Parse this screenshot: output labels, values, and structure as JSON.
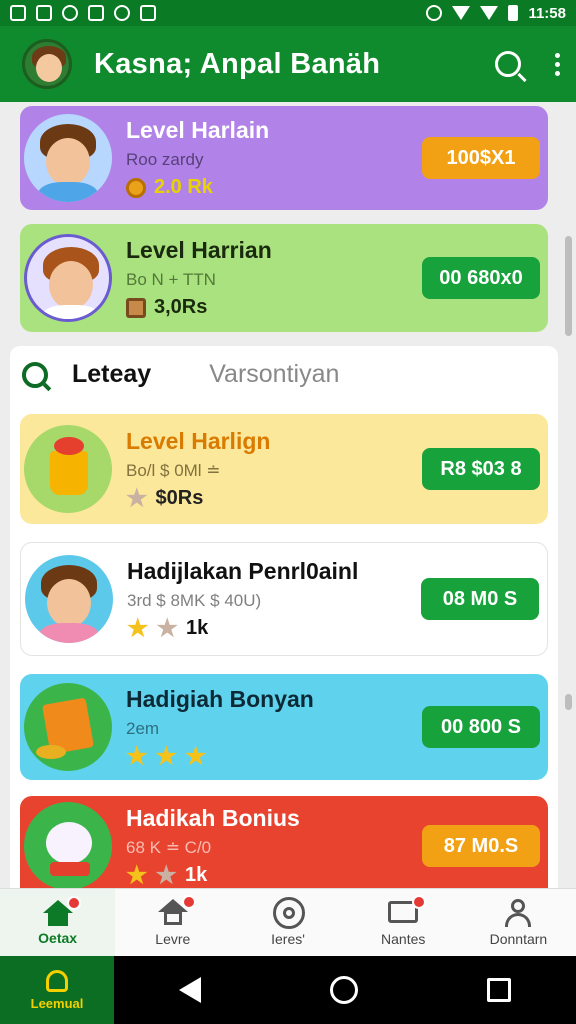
{
  "status_bar": {
    "time": "11:58"
  },
  "app_bar": {
    "title": "Kasna; Anpal Banäh"
  },
  "cards_top": [
    {
      "title": "Level Harlain",
      "subtitle": "Roo zardy",
      "value": "2.0 Rk",
      "button": "100$X1",
      "theme": "purple"
    },
    {
      "title": "Level Harrian",
      "subtitle": "Bo N + TTN",
      "value": "3,0Rs",
      "button": "00 680x0",
      "theme": "green"
    }
  ],
  "section": {
    "tab_active": "Leteay",
    "tab_inactive": "Varsontiyan"
  },
  "cards_list": [
    {
      "title": "Level Harlign",
      "subtitle": "Bo/l $ 0Ml ≐",
      "value": "$0Rs",
      "button": "R8 $03 8",
      "theme": "yellow",
      "stars": 1
    },
    {
      "title": "Hadijlakan Penrl0ainl",
      "subtitle": "3rd $ 8MK $ 40U)",
      "value": "1k",
      "button": "08 M0 S",
      "theme": "white",
      "stars": 1
    },
    {
      "title": "Hadigiah Bonyan",
      "subtitle": "2em",
      "value": "",
      "button": "00 800 S",
      "theme": "blue",
      "stars": 3
    },
    {
      "title": "Hadikah Bonius",
      "subtitle": "68 K ≐ C/0",
      "value": "1k",
      "button": "87 M0.S",
      "theme": "red",
      "stars": 2
    }
  ],
  "bottom_nav": [
    {
      "label": "Oetax",
      "icon": "home-icon",
      "active": true,
      "badge": true
    },
    {
      "label": "Levre",
      "icon": "house-icon",
      "active": false,
      "badge": true
    },
    {
      "label": "Ieres'",
      "icon": "wheel-icon",
      "active": false,
      "badge": false
    },
    {
      "label": "Nantes",
      "icon": "chat-icon",
      "active": false,
      "badge": true
    },
    {
      "label": "Donntarn",
      "icon": "user-icon",
      "active": false,
      "badge": false
    }
  ],
  "system_nav": {
    "app_label": "Leemual"
  },
  "colors": {
    "primary": "#0f8a2c",
    "purple": "#b183e8",
    "light_green": "#a9e27f",
    "yellow": "#fbe89a",
    "blue": "#5fd3ee",
    "red": "#e8432f",
    "orange_btn": "#f2a114",
    "green_btn": "#17a23c"
  }
}
